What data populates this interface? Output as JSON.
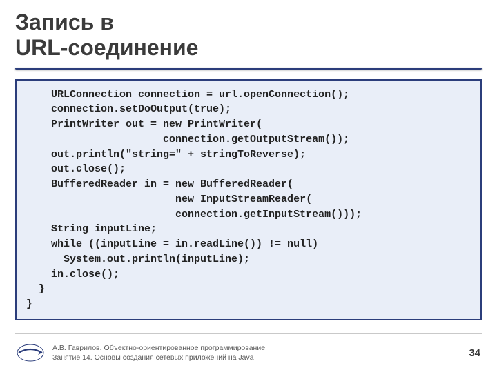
{
  "title_line1": "Запись в",
  "title_line2": "URL-соединение",
  "code": "    URLConnection connection = url.openConnection();\n    connection.setDoOutput(true);\n    PrintWriter out = new PrintWriter(\n                      connection.getOutputStream());\n    out.println(\"string=\" + stringToReverse);\n    out.close();\n    BufferedReader in = new BufferedReader(\n                        new InputStreamReader(\n                        connection.getInputStream()));\n    String inputLine;\n    while ((inputLine = in.readLine()) != null)\n      System.out.println(inputLine);\n    in.close();\n  }\n}",
  "footer": {
    "line1": "А.В. Гаврилов. Объектно-ориентированное программирование",
    "line2": "Занятие 14. Основы создания сетевых приложений на Java"
  },
  "page_number": "34"
}
